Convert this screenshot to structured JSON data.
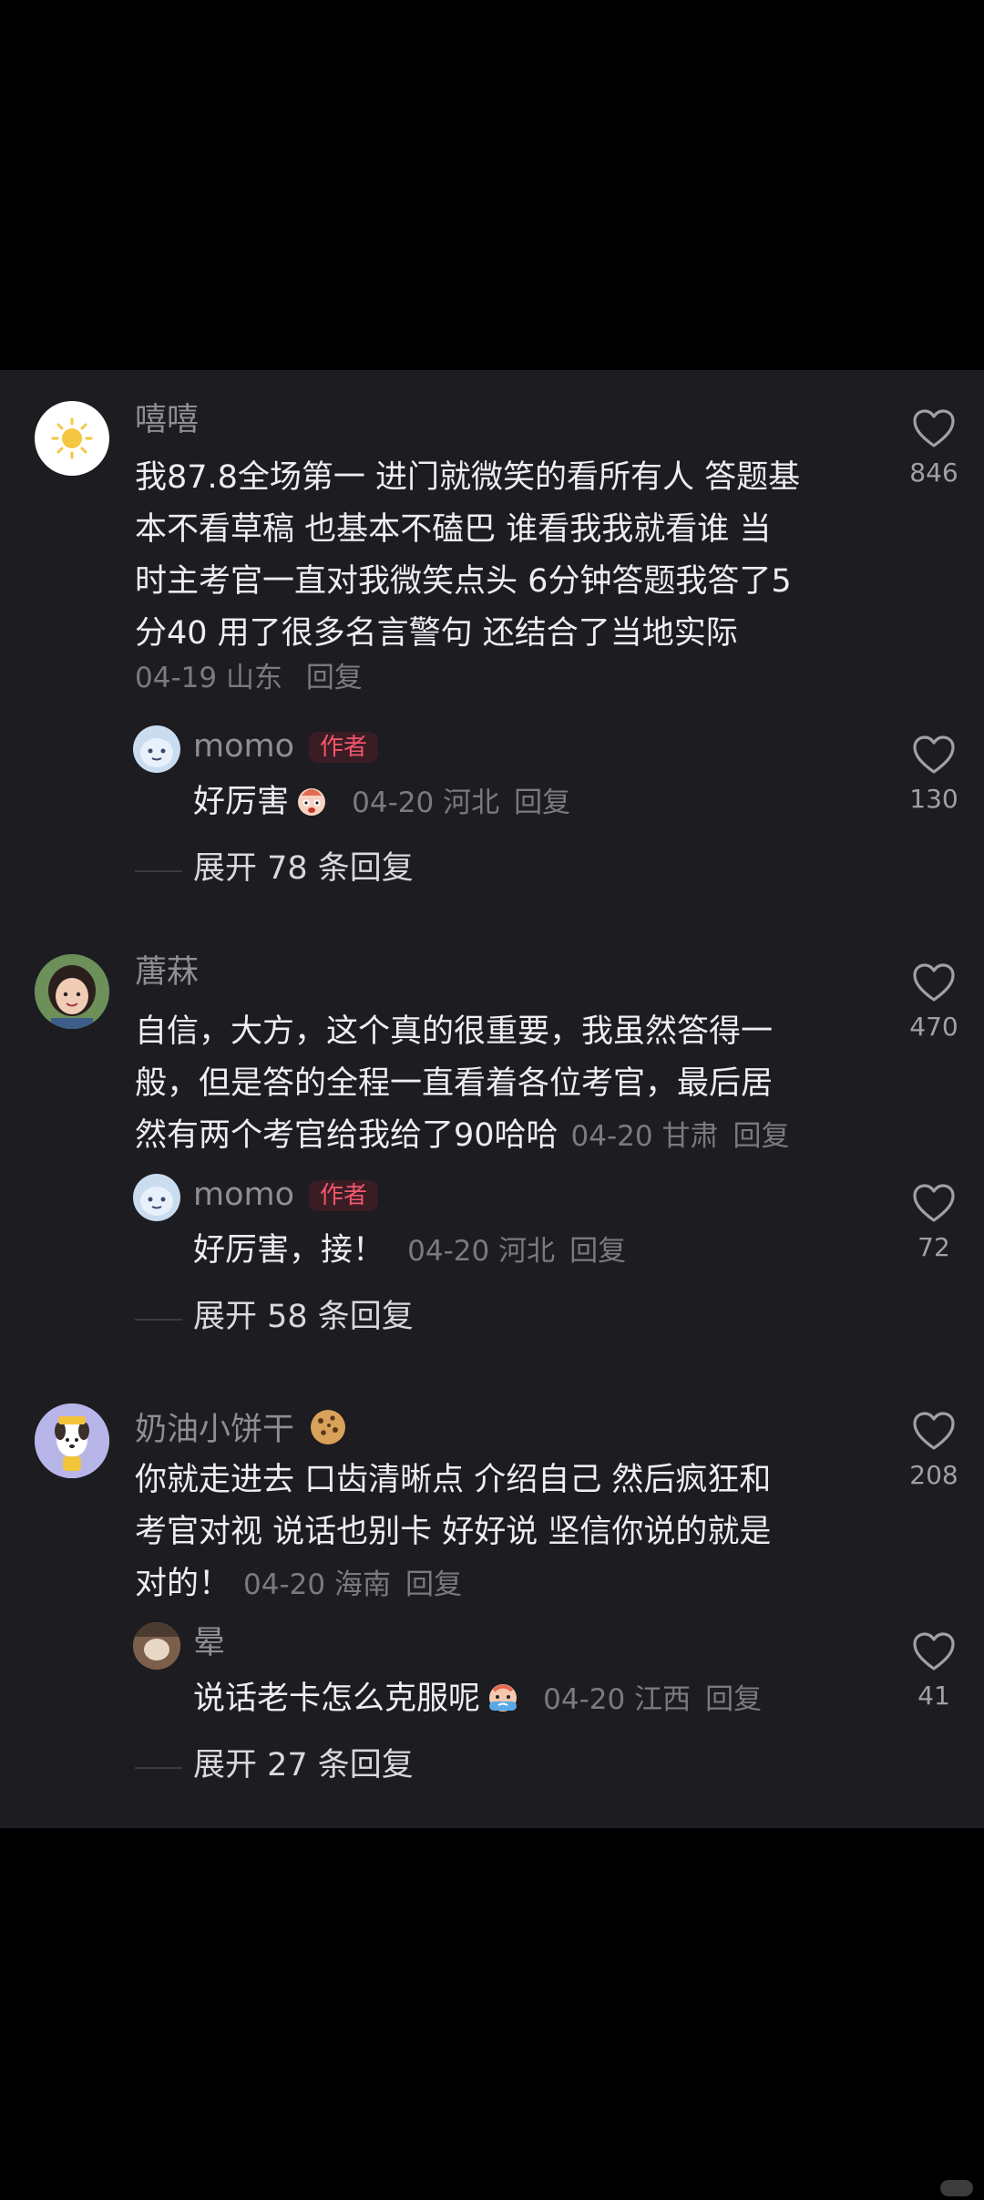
{
  "comments": [
    {
      "username": "嘻嘻",
      "lines": [
        "我87.8全场第一 进门就微笑的看所有人 答题基",
        "本不看草稿 也基本不磕巴 谁看我我就看谁 当",
        "时主考官一直对我微笑点头 6分钟答题我答了5",
        "分40 用了很多名言警句 还结合了当地实际"
      ],
      "date": "04-19",
      "location": "山东",
      "reply_label": "回复",
      "likes": "846",
      "avatar_icon": "sun-icon",
      "reply": {
        "username": "momo",
        "badge": "作者",
        "text": "好厉害",
        "emoji": "scared-face-emoji",
        "date": "04-20",
        "location": "河北",
        "reply_label": "回复",
        "likes": "130"
      },
      "expand": "展开 78 条回复"
    },
    {
      "username": "蓎菻",
      "lines": [
        "自信，大方，这个真的很重要，我虽然答得一",
        "般，但是答的全程一直看着各位考官，最后居",
        "然有两个考官给我给了90哈哈"
      ],
      "date": "04-20",
      "location": "甘肃",
      "reply_label": "回复",
      "likes": "470",
      "avatar_icon": "girl-photo-avatar",
      "reply": {
        "username": "momo",
        "badge": "作者",
        "text": "好厉害，接！",
        "date": "04-20",
        "location": "河北",
        "reply_label": "回复",
        "likes": "72"
      },
      "expand": "展开 58 条回复"
    },
    {
      "username": "奶油小饼干",
      "username_emoji": "cookie-emoji",
      "lines": [
        "你就走进去 口齿清晰点 介绍自己 然后疯狂和",
        "考官对视 说话也别卡 好好说 坚信你说的就是",
        "对的！"
      ],
      "date": "04-20",
      "location": "海南",
      "reply_label": "回复",
      "likes": "208",
      "avatar_icon": "cartoon-dog-avatar",
      "reply": {
        "username": "晕",
        "text": "说话老卡怎么克服呢",
        "emoji": "sweating-face-emoji",
        "date": "04-20",
        "location": "江西",
        "reply_label": "回复",
        "likes": "41"
      },
      "expand": "展开 27 条回复"
    }
  ],
  "colors": {
    "background": "#000000",
    "panel": "#1c1c21",
    "text": "#ededf2",
    "muted": "#7a7a80",
    "author_badge": "#f2566b"
  }
}
